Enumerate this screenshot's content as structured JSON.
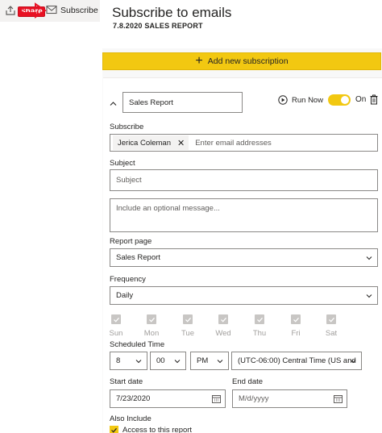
{
  "toolbar": {
    "share_label": "Share",
    "subscribe_label": "Subscribe"
  },
  "header": {
    "title": "Subscribe to emails",
    "report_name": "7.8.2020 SALES REPORT"
  },
  "add_subscription_label": "Add new subscription",
  "subscription": {
    "name": "Sales Report",
    "run_now_label": "Run Now",
    "toggle_label": "On",
    "toggle_on": true,
    "subscribe_label": "Subscribe",
    "recipient": "Jerica Coleman",
    "recipient_placeholder": "Enter email addresses",
    "subject_label": "Subject",
    "subject_placeholder": "Subject",
    "message_placeholder": "Include an optional message...",
    "report_page_label": "Report page",
    "report_page_value": "Sales Report",
    "frequency_label": "Frequency",
    "frequency_value": "Daily",
    "days": [
      "Sun",
      "Mon",
      "Tue",
      "Wed",
      "Thu",
      "Fri",
      "Sat"
    ],
    "scheduled_time_label": "Scheduled Time",
    "hour": "8",
    "minute": "00",
    "ampm": "PM",
    "timezone": "(UTC-06:00) Central Time (US and",
    "start_date_label": "Start date",
    "start_date": "7/23/2020",
    "end_date_label": "End date",
    "end_date_placeholder": "M/d/yyyy",
    "also_include_label": "Also Include",
    "access_label": "Access to this report"
  },
  "colors": {
    "accent": "#f2c811",
    "share_highlight": "#e81123"
  }
}
